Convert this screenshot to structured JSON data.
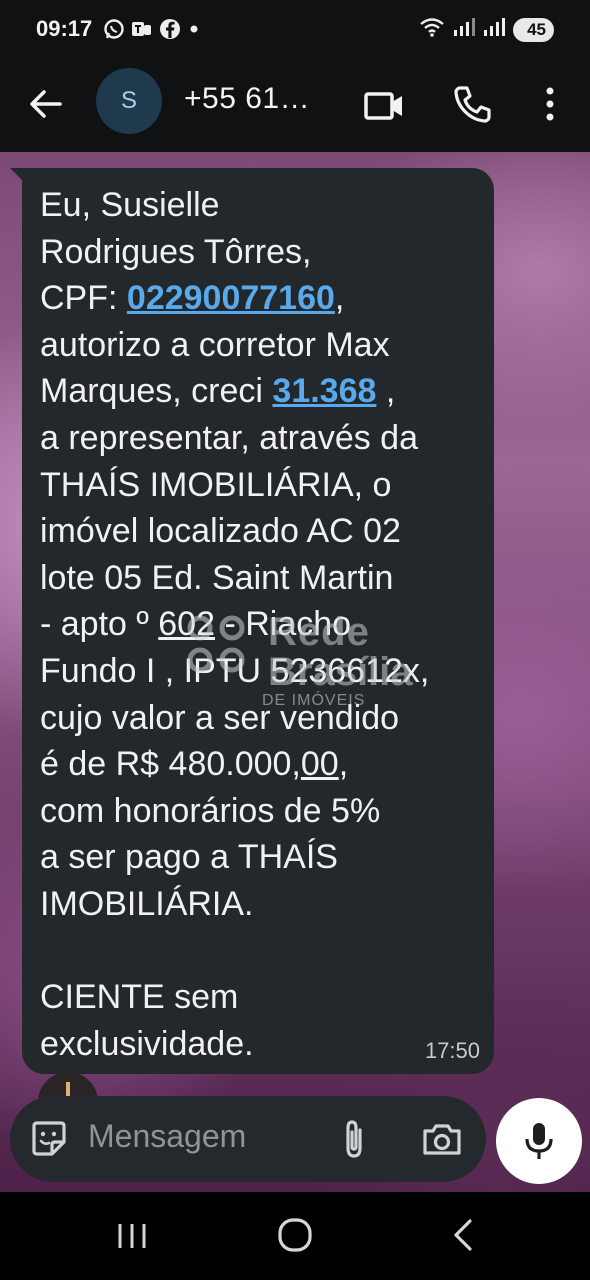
{
  "status_bar": {
    "time": "09:17",
    "battery": "45",
    "notification_icons": [
      "whatsapp-icon",
      "ms-teams-icon",
      "facebook-icon",
      "dot-icon"
    ],
    "system_icons": [
      "wifi-icon",
      "signal-icon",
      "signal-icon"
    ]
  },
  "header": {
    "avatar_letter": "S",
    "contact_name": "+55 61…",
    "icons": [
      "back-arrow-icon",
      "video-call-icon",
      "phone-icon",
      "more-vert-icon"
    ]
  },
  "message": {
    "lines": [
      [
        "Eu, Susielle"
      ],
      [
        "Rodrigues Tôrres,"
      ],
      [
        "CPF: ",
        {
          "link": "02290077160"
        },
        ","
      ],
      [
        "autorizo a corretor Max"
      ],
      [
        "Marques, creci ",
        {
          "link": "31.368"
        },
        " ,"
      ],
      [
        "a representar, através da"
      ],
      [
        "THAÍS IMOBILIÁRIA, o"
      ],
      [
        "imóvel localizado AC 02"
      ],
      [
        "lote 05 Ed. Saint Martin"
      ],
      [
        "- apto º ",
        {
          "u": "602"
        },
        " - Riacho"
      ],
      [
        "Fundo I , IPTU 5236612x,"
      ],
      [
        "cujo valor a ser vendido"
      ],
      [
        "é de R$ 480.000,",
        {
          "u": "00"
        },
        ","
      ],
      [
        "com honorários de 5%"
      ],
      [
        "a ser pago a THAÍS"
      ],
      [
        "IMOBILIÁRIA."
      ],
      [
        ""
      ],
      [
        "CIENTE sem"
      ],
      [
        "exclusividade."
      ]
    ],
    "time": "17:50"
  },
  "watermark": {
    "line1": "Rede",
    "line2": "Brasília",
    "line3": "DE IMÓVEIS"
  },
  "compose": {
    "placeholder": "Mensagem",
    "icons": [
      "sticker-icon",
      "paperclip-icon",
      "camera-icon",
      "microphone-icon"
    ]
  },
  "nav": {
    "icons": [
      "recent-apps-icon",
      "home-icon",
      "nav-back-icon"
    ]
  },
  "colors": {
    "bubble": "#23282c",
    "link": "#5aa9ea",
    "app_bar": "#0f1113",
    "compose": "#24292e"
  }
}
